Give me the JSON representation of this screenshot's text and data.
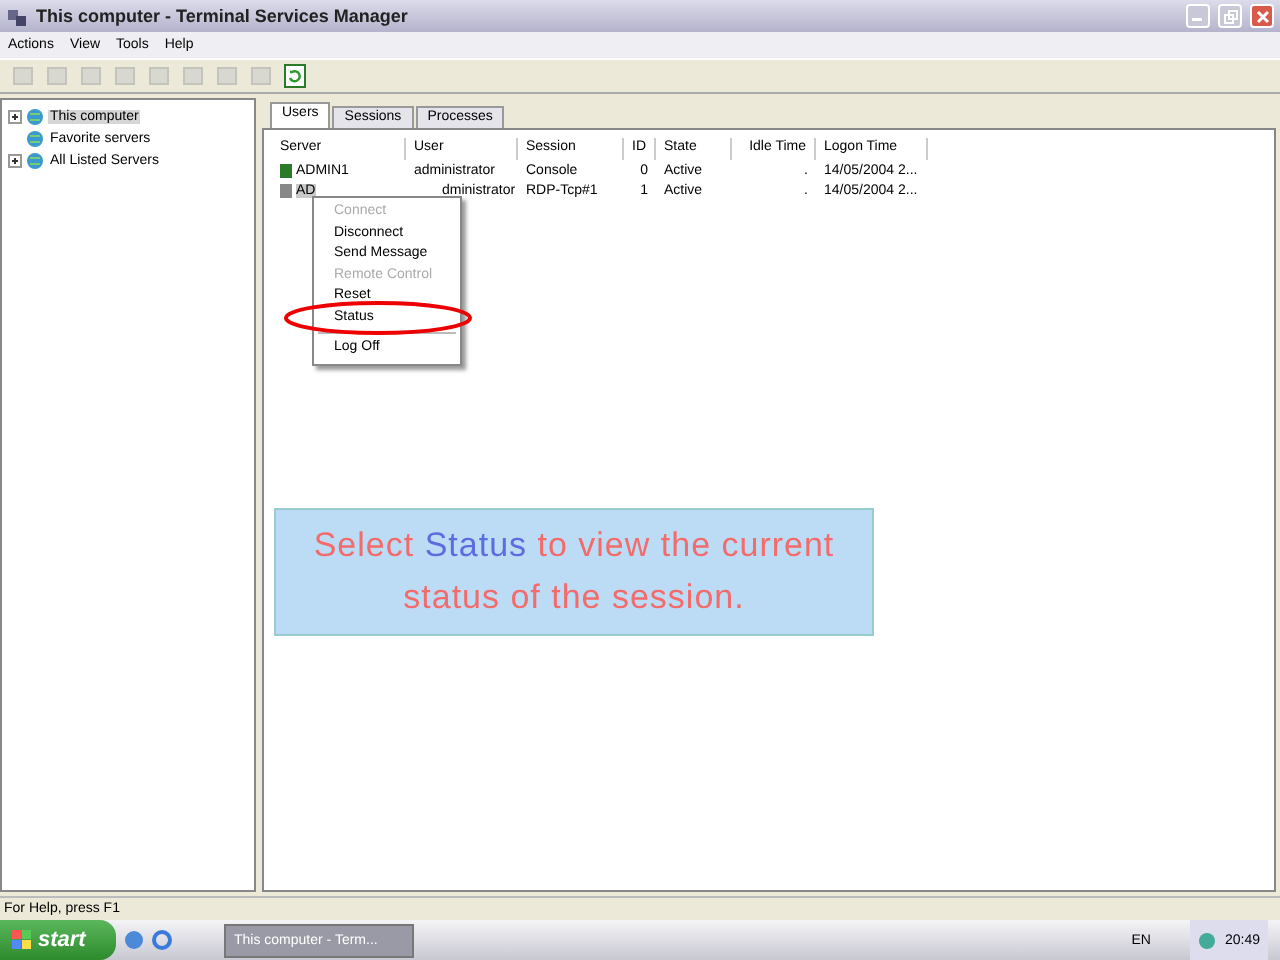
{
  "window": {
    "title": "This computer - Terminal Services Manager"
  },
  "menu": [
    "Actions",
    "View",
    "Tools",
    "Help"
  ],
  "toolbar": [
    {
      "disabled": true
    },
    {
      "disabled": true
    },
    {
      "disabled": true
    },
    {
      "disabled": true
    },
    {
      "disabled": true
    },
    {
      "disabled": true
    },
    {
      "disabled": true
    },
    {
      "disabled": true
    },
    {
      "disabled": false
    }
  ],
  "tree": [
    {
      "label": "This computer",
      "selected": true,
      "has_children": true
    },
    {
      "label": "Favorite servers",
      "selected": false,
      "has_children": false
    },
    {
      "label": "All Listed Servers",
      "selected": false,
      "has_children": true
    }
  ],
  "tabs": [
    {
      "label": "Users",
      "selected": true
    },
    {
      "label": "Sessions",
      "selected": false
    },
    {
      "label": "Processes",
      "selected": false
    }
  ],
  "table": {
    "columns": [
      "Server",
      "User",
      "Session",
      "ID",
      "State",
      "Idle Time",
      "Logon Time"
    ],
    "rows": [
      {
        "selected": false,
        "cells": [
          "ADMIN1",
          "administrator",
          "Console",
          "0",
          "Active",
          ".",
          "14/05/2004 2..."
        ]
      },
      {
        "selected": true,
        "cells": [
          "AD",
          "dministrator",
          "RDP-Tcp#1",
          "1",
          "Active",
          ".",
          "14/05/2004 2..."
        ]
      }
    ]
  },
  "context_menu": [
    {
      "kind": "item",
      "label": "Connect",
      "disabled": true,
      "circled": false
    },
    {
      "kind": "item",
      "label": "Disconnect",
      "disabled": false,
      "circled": false
    },
    {
      "kind": "item",
      "label": "Send Message",
      "disabled": false,
      "circled": false
    },
    {
      "kind": "item",
      "label": "Remote Control",
      "disabled": true,
      "circled": false
    },
    {
      "kind": "item",
      "label": "Reset",
      "disabled": false,
      "circled": false
    },
    {
      "kind": "item",
      "label": "Status",
      "disabled": false,
      "circled": true
    },
    {
      "kind": "separator"
    },
    {
      "kind": "item",
      "label": "Log Off",
      "disabled": false,
      "circled": false
    }
  ],
  "callout": [
    {
      "text": "Select ",
      "emphasis": false
    },
    {
      "text": "Status",
      "emphasis": true
    },
    {
      "text": " to view the current status of the session.",
      "emphasis": false
    }
  ],
  "status_bar": "For Help, press F1",
  "taskbar": {
    "start": "start",
    "task": "This computer - Term...",
    "language": "EN",
    "clock": "20:49"
  }
}
